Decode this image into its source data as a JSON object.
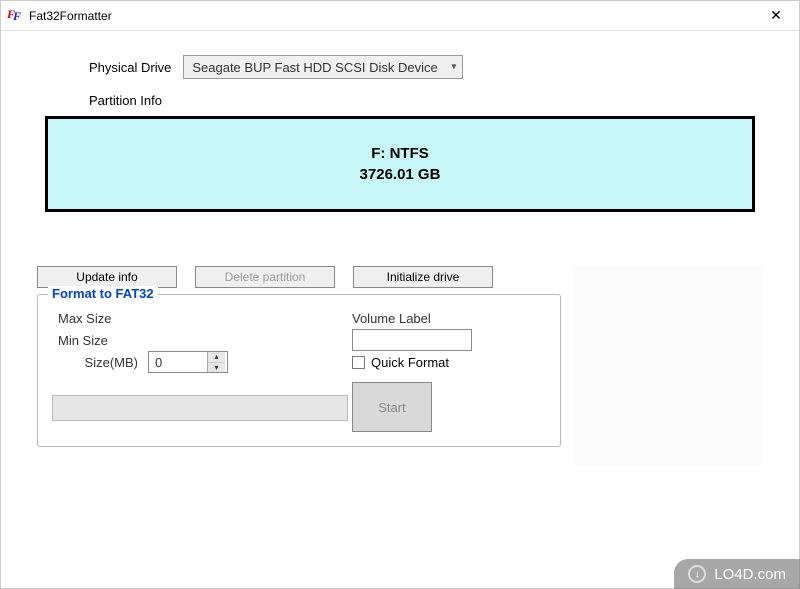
{
  "window": {
    "title": "Fat32Formatter"
  },
  "drive": {
    "label": "Physical Drive",
    "selected": "Seagate BUP Fast HDD SCSI Disk Device"
  },
  "partition": {
    "label": "Partition Info",
    "volume_line": "F: NTFS",
    "size_line": "3726.01 GB"
  },
  "buttons": {
    "update": "Update info",
    "delete": "Delete partition",
    "init": "Initialize drive"
  },
  "format_group": {
    "legend": "Format to FAT32",
    "max_label": "Max Size",
    "min_label": "Min Size",
    "size_label": "Size(MB)",
    "size_value": "0",
    "volume_label": "Volume Label",
    "volume_value": "",
    "quick_label": "Quick Format",
    "start_label": "Start"
  },
  "watermark": {
    "text": "LO4D.com"
  }
}
